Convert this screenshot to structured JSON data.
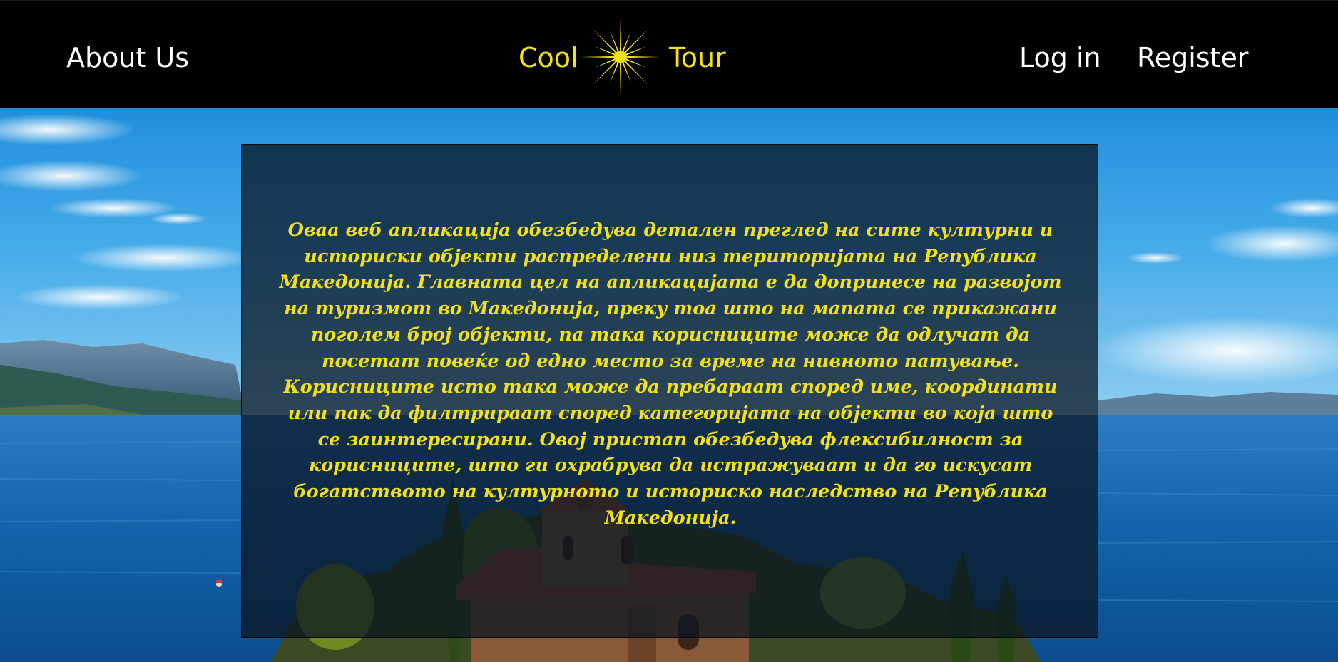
{
  "nav": {
    "about_label": "About Us",
    "login_label": "Log in",
    "register_label": "Register"
  },
  "brand": {
    "left_word": "Cool",
    "right_word": "Tour",
    "emblem_icon": "vergina-sun-icon",
    "color": "#f5e10f"
  },
  "background": {
    "description_icon": "lake-landscape-image"
  },
  "info": {
    "text": "Оваа веб апликација обезбедува детален преглед на сите културни и историски објекти распределени низ територијата на Република Македонија. Главната цел на апликацијата е да допринесе на развојот на туризмот во Македонија, преку тоа што на мапата се прикажани поголем број објекти, па така корисниците може да одлучат да посетат повеќе од едно место за време на нивното патување. Корисниците исто така може да пребараат според име, координати или пак да филтрираат според категоријата на објекти во која што се заинтересирани. Овој пристап обезбедува флексибилност за корисниците, што ги охрабрува да истражуваат и да го искусат богатството на културното и историско наследство на Република Македонија.",
    "text_color": "#f2e01a"
  },
  "colors": {
    "navbar_bg": "#000000",
    "nav_text": "#ffffff",
    "accent_yellow": "#f5e10f"
  }
}
